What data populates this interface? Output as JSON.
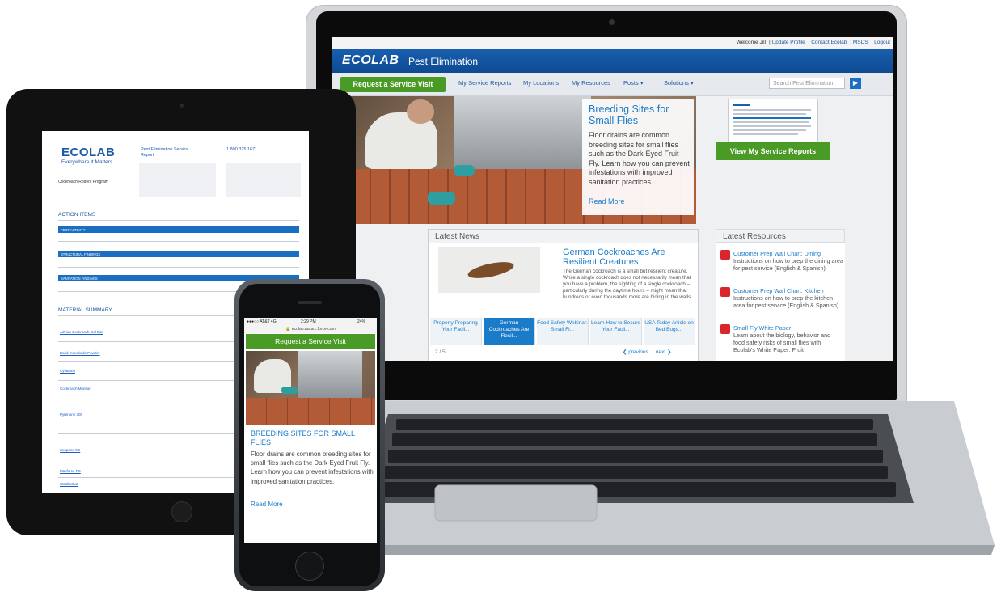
{
  "laptop": {
    "topbar": {
      "welcome": "Welcome Jill",
      "links": [
        "Update Profile",
        "Contact Ecolab",
        "MSDS",
        "Logout"
      ]
    },
    "brand": {
      "logo": "ECOLAB",
      "product": "Pest Elimination"
    },
    "nav": {
      "request_button": "Request a Service Visit",
      "links": [
        "My Service Reports",
        "My Locations",
        "My Resources",
        "Posts",
        "Solutions"
      ],
      "search_placeholder": "Search Pest Elimination"
    },
    "hero": {
      "title": "Breeding Sites for Small Flies",
      "body": "Floor drains are common breeding sites for small flies such as the Dark-Eyed Fruit Fly. Learn how you can prevent infestations with improved sanitation practices.",
      "read_more": "Read More"
    },
    "service_reports_button": "View My Service Reports",
    "news": {
      "header": "Latest News",
      "title": "German Cockroaches Are Resilient Creatures",
      "body": "The German cockroach is a small but resilient creature. While a single cockroach does not necessarily mean that you have a problem, the sighting of a single cockroach – particularly during the daytime hours – might mean that hundreds or even thousands more are hiding in the walls.",
      "tabs": [
        {
          "label": "Property Preparing Your Facil..."
        },
        {
          "label": "German Cockroaches Are Resil..."
        },
        {
          "label": "Food Safety Webinar: Small Fl..."
        },
        {
          "label": "Learn How to Secure Your Facil..."
        },
        {
          "label": "USA Today Article on Bed Bugs..."
        }
      ],
      "pager": "2 / 5",
      "prev": "❮ previous",
      "next": "next ❯"
    },
    "resources": {
      "header": "Latest Resources",
      "items": [
        {
          "title": "Customer Prep Wall Chart: Dining",
          "desc": "Instructions on how to prep the dining area for pest service (English & Spanish)"
        },
        {
          "title": "Customer Prep Wall Chart: Kitchen",
          "desc": "Instructions on how to prep the kitchen area for pest service (English & Spanish)"
        },
        {
          "title": "Small Fly White Paper",
          "desc": "Learn about the biology, behavior and food safety risks of small flies with Ecolab's White Paper: Fruit"
        }
      ]
    }
  },
  "tablet": {
    "logo": "ECOLAB",
    "tagline": "Everywhere It Matters.",
    "report_title": "Pest Elimination Service Report",
    "phone_number": "1 800 325 1671",
    "program": "Cockroach Rodent Program",
    "sections": {
      "action_items": "ACTION ITEMS",
      "material_summary": "MATERIAL SUMMARY"
    },
    "action_rows": [
      "PEST ACTIVITY",
      "STRUCTURAL FINDINGS",
      "SANITATION FINDINGS"
    ],
    "materials": [
      "Advion Cockroach Gel Bait",
      "Borid Insecticide Powder",
      "Cyfluthrin",
      "Cockroach Monitor",
      "Pyrenone 300",
      "Suspend SC",
      "Maxforce FC",
      "Stealthshot"
    ]
  },
  "phone": {
    "carrier": "●●●○○ AT&T 4G",
    "time": "2:29 PM",
    "battery": "24%",
    "url": "ecolab.azcsrc.force.com",
    "request_button": "Request a Service Visit",
    "title": "BREEDING SITES FOR SMALL FLIES",
    "body": "Floor drains are common breeding sites for small flies such as the Dark-Eyed Fruit Fly. Learn how you can prevent infestations with improved sanitation practices.",
    "read_more": "Read More"
  },
  "colors": {
    "brand_blue": "#1a5fb0",
    "action_green": "#4a9a26",
    "link_blue": "#1a7bc9",
    "pdf_red": "#d9262b"
  }
}
